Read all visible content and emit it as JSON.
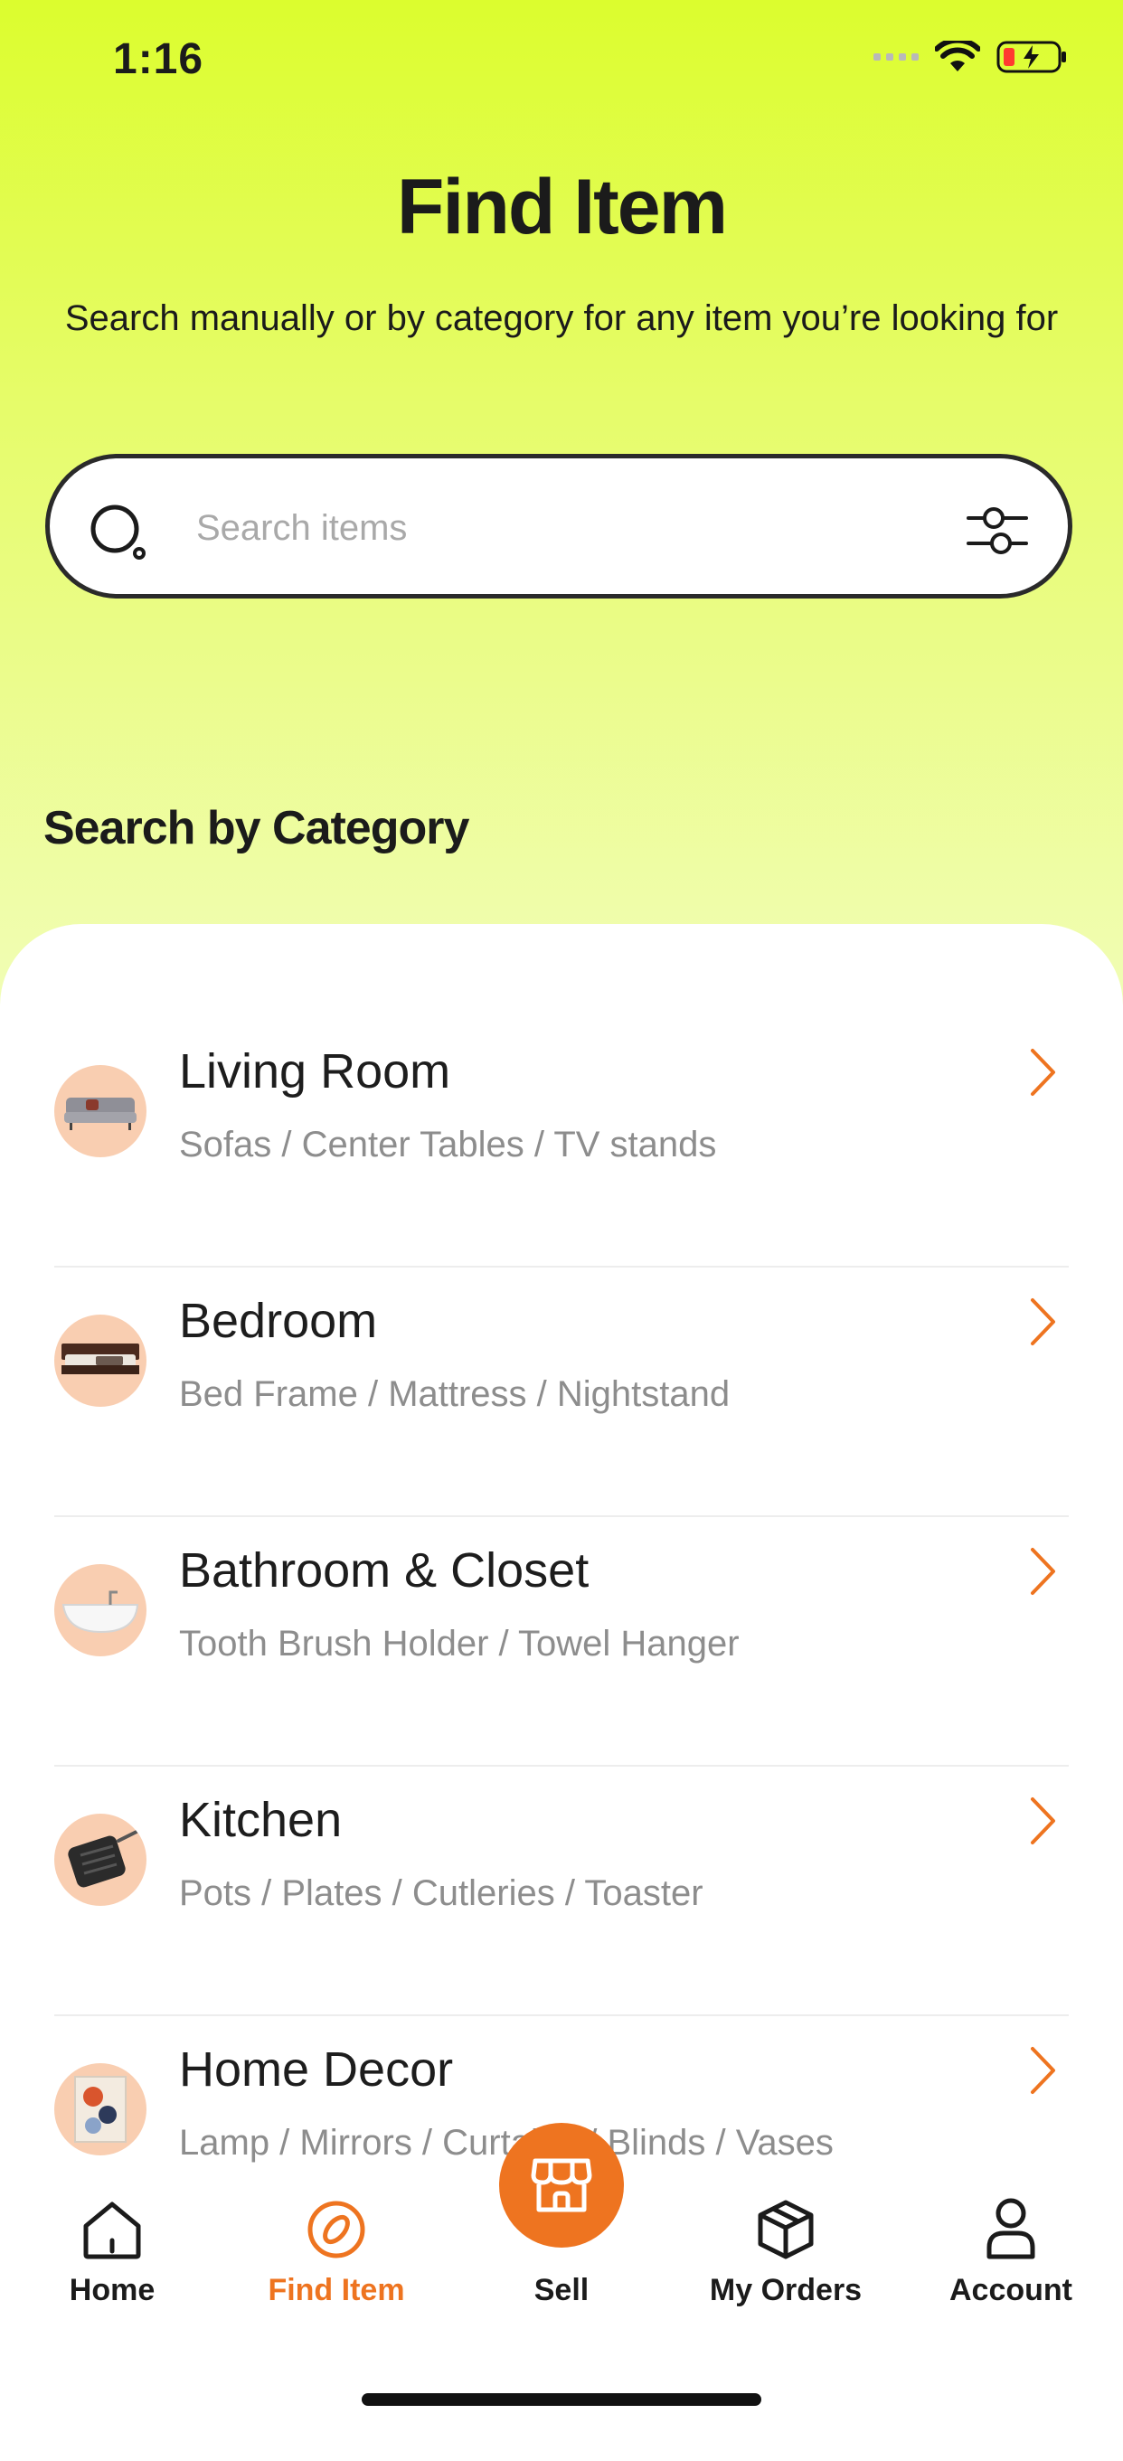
{
  "status_bar": {
    "time": "1:16"
  },
  "header": {
    "title": "Find Item",
    "subtitle": "Search manually or by category for any item you’re looking for"
  },
  "search": {
    "placeholder": "Search items",
    "value": ""
  },
  "section": {
    "title": "Search by Category"
  },
  "categories": [
    {
      "title": "Living Room",
      "subtitle": "Sofas / Center Tables / TV stands",
      "icon": "sofa-thumbnail"
    },
    {
      "title": "Bedroom",
      "subtitle": "Bed Frame / Mattress / Nightstand",
      "icon": "bed-thumbnail"
    },
    {
      "title": "Bathroom & Closet",
      "subtitle": "Tooth Brush Holder / Towel Hanger",
      "icon": "bathtub-thumbnail"
    },
    {
      "title": "Kitchen",
      "subtitle": "Pots / Plates / Cutleries / Toaster",
      "icon": "pan-thumbnail"
    },
    {
      "title": "Home Decor",
      "subtitle": "Lamp / Mirrors / Curtains / Blinds / Vases",
      "icon": "art-thumbnail"
    }
  ],
  "nav": {
    "items": [
      {
        "label": "Home",
        "icon": "home-icon"
      },
      {
        "label": "Find Item",
        "icon": "find-icon",
        "active": true
      },
      {
        "label": "Sell",
        "icon": "store-icon"
      },
      {
        "label": "My Orders",
        "icon": "box-icon"
      },
      {
        "label": "Account",
        "icon": "user-icon"
      }
    ]
  },
  "colors": {
    "accent": "#ee7420",
    "gradient_top": "#dcfd2e",
    "gradient_bottom": "#f1fdb6"
  }
}
